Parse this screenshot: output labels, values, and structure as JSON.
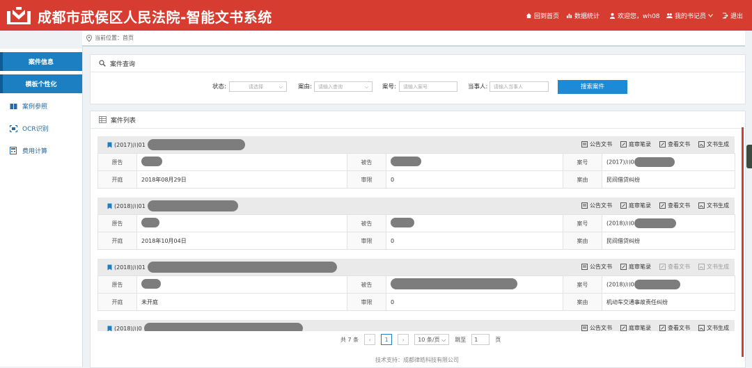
{
  "header": {
    "title": "成都市武侯区人民法院-智能文书系统",
    "nav": {
      "home": "回到首页",
      "stats": "数据统计",
      "welcome": "欢迎您，wh08",
      "my_records": "我的书记员",
      "logout": "退出"
    }
  },
  "sidebar": {
    "items": [
      {
        "label": "案件信息"
      },
      {
        "label": "模板个性化"
      },
      {
        "label": "案例参照"
      },
      {
        "label": "OCR识别"
      },
      {
        "label": "费用计算"
      }
    ]
  },
  "breadcrumb": "当前位置：首页",
  "search": {
    "title": "案件查询",
    "status_label": "状态:",
    "status_placeholder": "请选择",
    "cause_label": "案由:",
    "cause_placeholder": "请输入查询",
    "case_no_label": "案号:",
    "case_no_placeholder": "请输入案号",
    "party_label": "当事人:",
    "party_placeholder": "请输入当事人",
    "button": "搜索案件"
  },
  "list": {
    "title": "案件列表",
    "labels": {
      "plaintiff": "原告",
      "defendant": "被告",
      "case_no": "案号",
      "hearing": "开庭",
      "term": "审限",
      "cause": "案由"
    },
    "actions": {
      "announce": "公告文书",
      "record": "庭审笔录",
      "view": "查看文书",
      "generate": "文书生成"
    },
    "cases": [
      {
        "number": "(2017)川01",
        "case_no": "(2017)川0",
        "hearing": "2018年08月29日",
        "term": "0",
        "cause": "民间借贷纠纷"
      },
      {
        "number": "(2018)川01",
        "case_no": "(2018)川0",
        "hearing": "2018年10月04日",
        "term": "0",
        "cause": "民间借贷纠纷"
      },
      {
        "number": "(2018)川01",
        "case_no": "(2018)川0",
        "hearing": "未开庭",
        "term": "0",
        "cause": "机动车交通事故责任纠纷"
      },
      {
        "number": "(2018)川0"
      }
    ]
  },
  "pager": {
    "total": "共 7 条",
    "current": "1",
    "page_size": "10 条/页",
    "jump_label": "跳至",
    "jump_value": "1",
    "page_unit": "页"
  },
  "footer": "技术支持：成都律皓科技有限公司",
  "colors": {
    "header": "#d63c30",
    "accent": "#1c7fc2",
    "hearing_date": "#c0392b"
  }
}
